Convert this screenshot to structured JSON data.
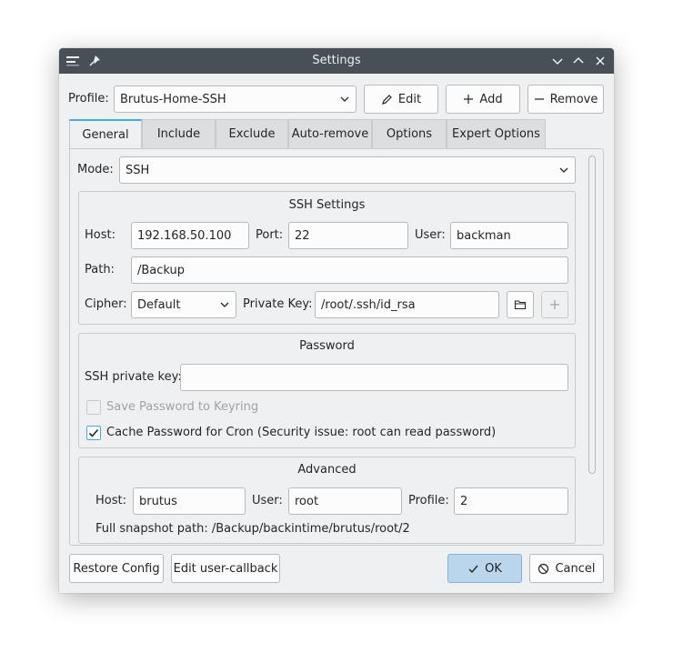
{
  "window": {
    "title": "Settings"
  },
  "profile": {
    "label": "Profile:",
    "value": "Brutus-Home-SSH",
    "edit_label": "Edit",
    "add_label": "Add",
    "remove_label": "Remove"
  },
  "tabs": [
    {
      "label": "General"
    },
    {
      "label": "Include"
    },
    {
      "label": "Exclude"
    },
    {
      "label": "Auto-remove"
    },
    {
      "label": "Options"
    },
    {
      "label": "Expert Options"
    }
  ],
  "mode": {
    "label": "Mode:",
    "value": "SSH"
  },
  "ssh": {
    "title": "SSH Settings",
    "host_label": "Host:",
    "host": "192.168.50.100",
    "port_label": "Port:",
    "port": "22",
    "user_label": "User:",
    "user": "backman",
    "path_label": "Path:",
    "path": "/Backup",
    "cipher_label": "Cipher:",
    "cipher": "Default",
    "key_label": "Private Key:",
    "key": "/root/.ssh/id_rsa"
  },
  "password": {
    "title": "Password",
    "private_key_label": "SSH private key:",
    "private_key_value": "",
    "save_keyring_label": "Save Password to Keyring",
    "cache_cron_label": "Cache Password for Cron (Security issue: root can read password)"
  },
  "advanced": {
    "title": "Advanced",
    "host_label": "Host:",
    "host": "brutus",
    "user_label": "User:",
    "user": "root",
    "profile_label": "Profile:",
    "profile": "2",
    "snapshot_path": "Full snapshot path: /Backup/backintime/brutus/root/2"
  },
  "footer": {
    "restore_label": "Restore Config",
    "edit_callback_label": "Edit user-callback",
    "ok_label": "OK",
    "cancel_label": "Cancel"
  },
  "colors": {
    "accent": "#3daee9",
    "titlebar": "#475057",
    "ok_bg": "#b9d6ec"
  }
}
